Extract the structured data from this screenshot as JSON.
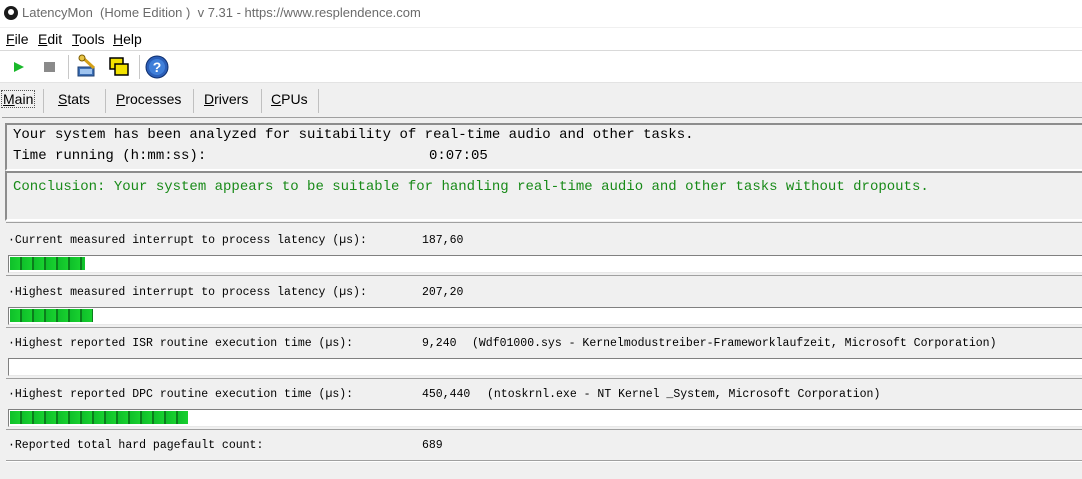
{
  "window": {
    "title": "LatencyMon  (Home Edition )  v 7.31 - https://www.resplendence.com"
  },
  "menu": [
    {
      "label": "File",
      "ul": "F",
      "rest": "ile"
    },
    {
      "label": "Edit",
      "ul": "E",
      "rest": "dit"
    },
    {
      "label": "Tools",
      "ul": "T",
      "rest": "ools"
    },
    {
      "label": "Help",
      "ul": "H",
      "rest": "elp"
    }
  ],
  "toolbar": {
    "icons": [
      "play-icon",
      "stop-icon",
      "analyze-icon",
      "windows-icon",
      "help-icon"
    ]
  },
  "tabs": [
    {
      "label": "Main",
      "ul": "M",
      "rest": "ain",
      "active": true
    },
    {
      "label": "Stats",
      "ul": "S",
      "rest": "tats"
    },
    {
      "label": "Processes",
      "ul": "P",
      "rest": "rocesses"
    },
    {
      "label": "Drivers",
      "ul": "D",
      "rest": "rivers"
    },
    {
      "label": "CPUs",
      "ul": "C",
      "rest": "PUs"
    }
  ],
  "summary": {
    "line1": "Your system has been analyzed for suitability of real-time audio and other tasks.",
    "time_label": "Time running (h:mm:ss):",
    "time_value": "0:07:05"
  },
  "conclusion": "Conclusion: Your system appears to be suitable for handling real-time audio and other tasks without dropouts.",
  "metrics": [
    {
      "label": "·Current measured interrupt to process latency (µs):",
      "value": "187,60",
      "detail": "",
      "level": 0.07
    },
    {
      "label": "·Highest measured interrupt to process latency (µs):",
      "value": "207,20",
      "detail": "",
      "level": 0.077
    },
    {
      "label": "·Highest reported ISR routine execution time (µs):",
      "value": "9,240",
      "detail": "(Wdf01000.sys - Kernelmodustreiber-Frameworklaufzeit, Microsoft Corporation)",
      "level": 0
    },
    {
      "label": "·Highest reported DPC routine execution time (µs):",
      "value": "450,440",
      "detail": "(ntoskrnl.exe - NT Kernel _System, Microsoft Corporation)",
      "level": 0.166
    },
    {
      "label": "·Reported total hard pagefault count:",
      "value": "689",
      "detail": "",
      "level": 0
    }
  ],
  "colors": {
    "conclusion": "#188a18",
    "bar_fill": "#18d12f"
  }
}
